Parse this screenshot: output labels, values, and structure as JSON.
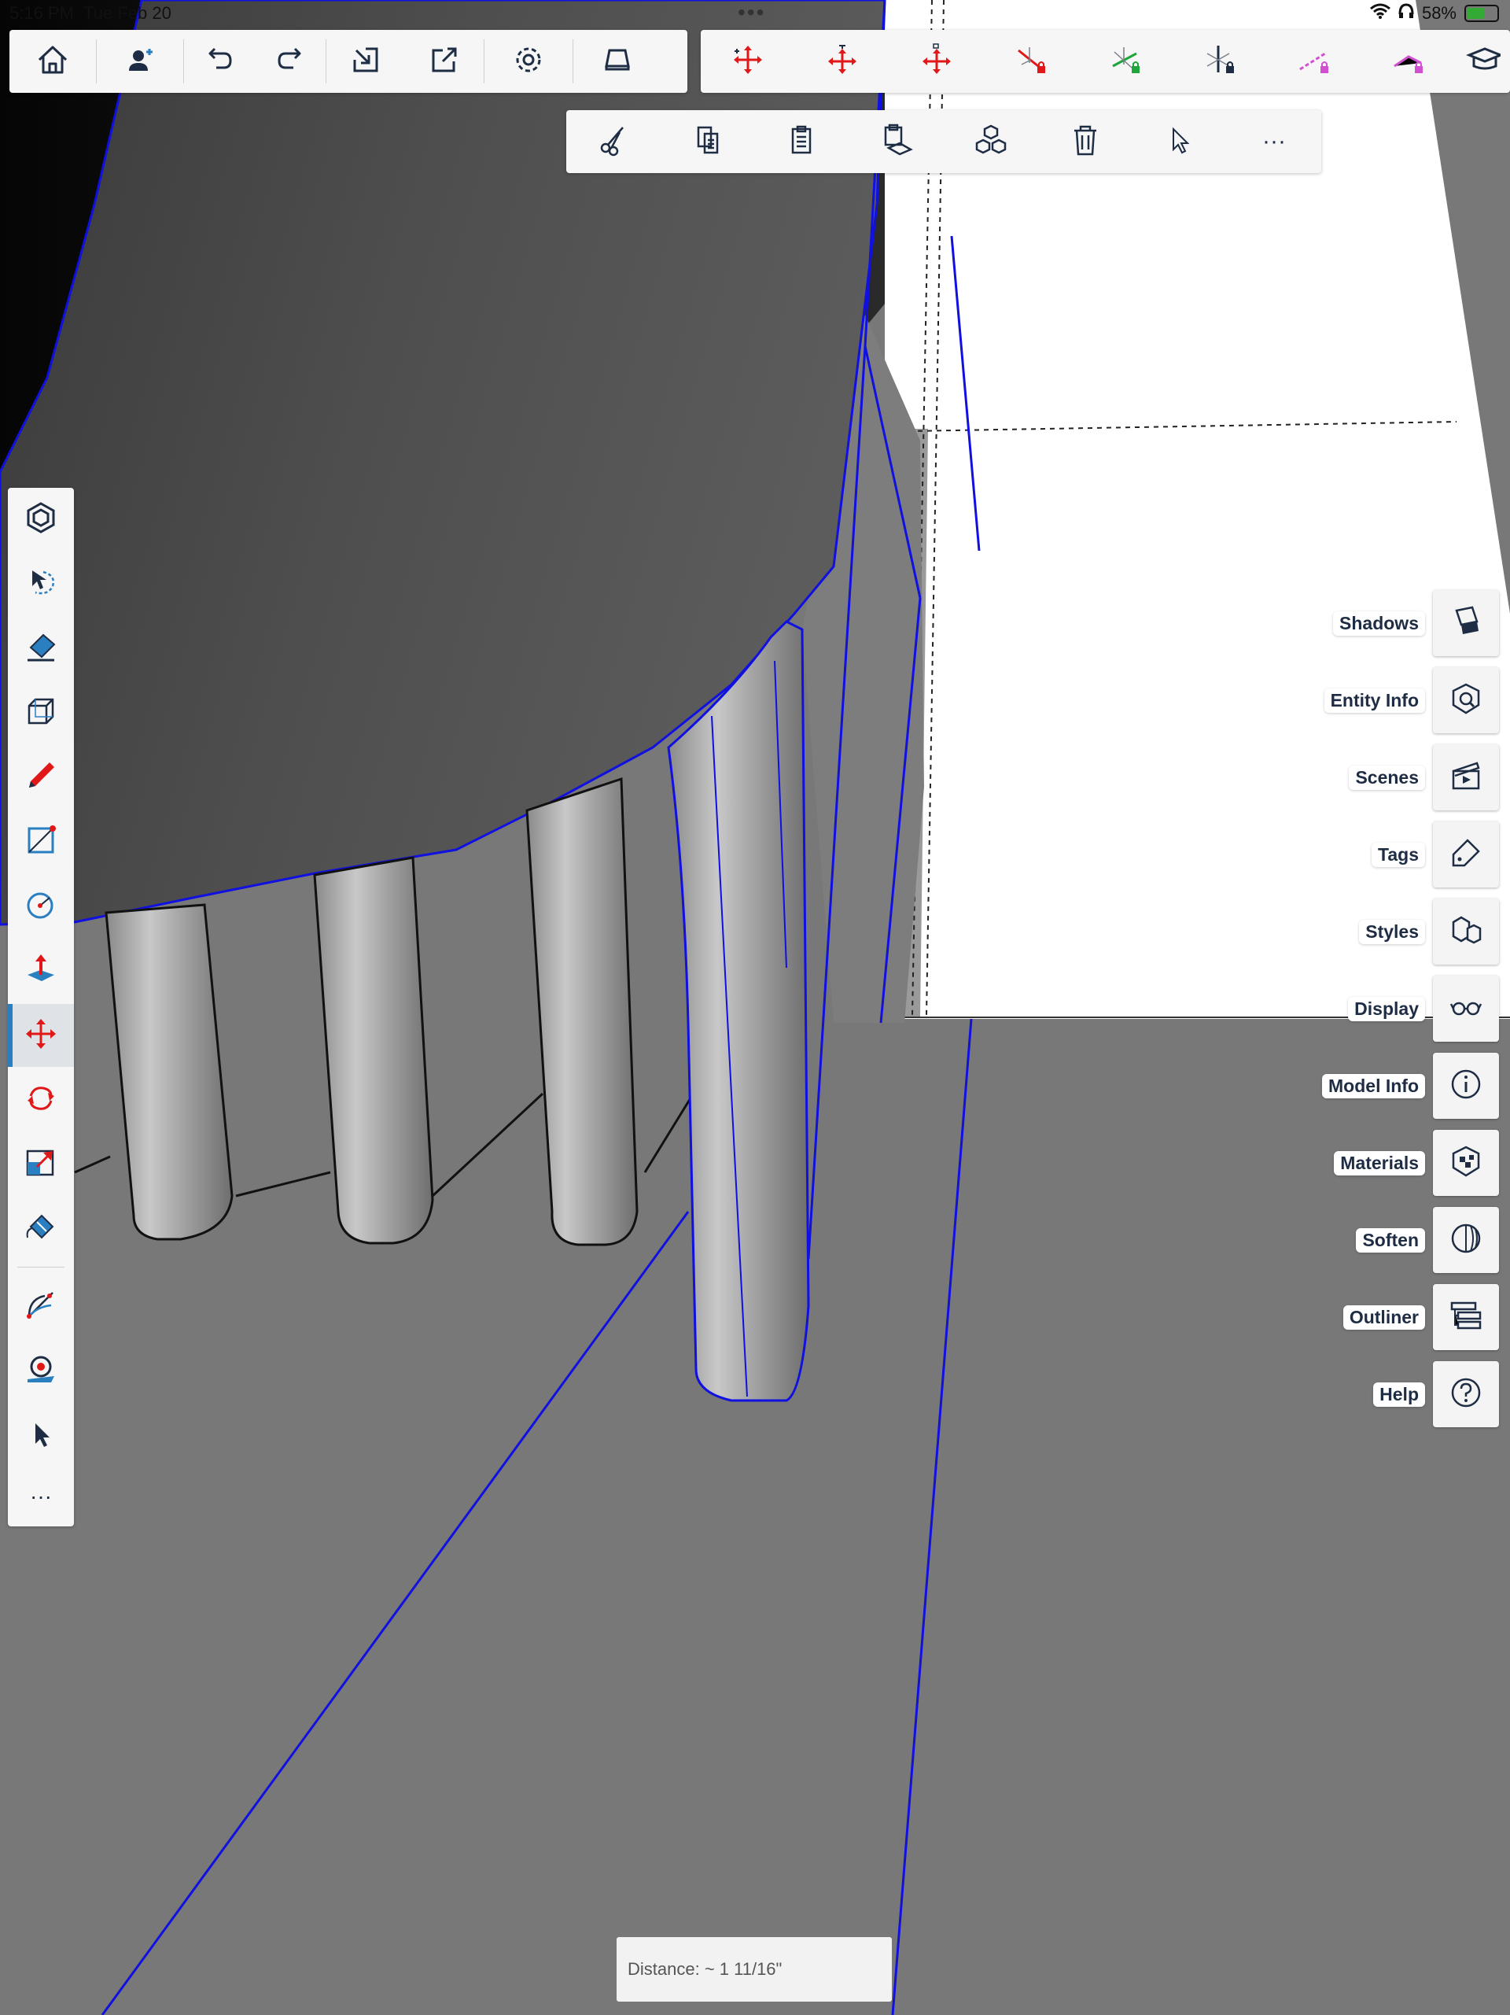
{
  "status_bar": {
    "time": "5:16 PM",
    "date": "Tue Feb 20",
    "dots": "•••",
    "battery": "58%"
  },
  "main_toolbar": [
    {
      "name": "home-button",
      "icon": "home-icon"
    },
    {
      "name": "add-user-button",
      "icon": "add-user-icon"
    },
    {
      "name": "undo-button",
      "icon": "undo-icon"
    },
    {
      "name": "redo-button",
      "icon": "redo-icon"
    },
    {
      "name": "import-button",
      "icon": "import-icon"
    },
    {
      "name": "export-button",
      "icon": "export-icon"
    },
    {
      "name": "settings-button",
      "icon": "gear-icon"
    },
    {
      "name": "view-button",
      "icon": "view-icon"
    }
  ],
  "inference_toolbar": [
    {
      "name": "move-inference-1",
      "icon": "move-arrows-icon"
    },
    {
      "name": "move-inference-2",
      "icon": "move-arrows-down-icon"
    },
    {
      "name": "move-inference-3",
      "icon": "move-arrows-up-icon"
    },
    {
      "name": "lock-red-axis",
      "icon": "red-axis-lock-icon"
    },
    {
      "name": "lock-green-axis",
      "icon": "green-axis-lock-icon"
    },
    {
      "name": "lock-blue-axis",
      "icon": "blue-axis-lock-icon"
    },
    {
      "name": "lock-magenta-1",
      "icon": "magenta-lock-icon"
    },
    {
      "name": "lock-magenta-2",
      "icon": "magenta-line-lock-icon"
    },
    {
      "name": "extra-tool",
      "icon": "cap-icon"
    }
  ],
  "edit_toolbar": [
    {
      "name": "cut-button",
      "icon": "scissors-icon"
    },
    {
      "name": "copy-button",
      "icon": "copy-icon"
    },
    {
      "name": "paste-button",
      "icon": "paste-icon"
    },
    {
      "name": "paste-in-place-button",
      "icon": "paste-in-place-icon"
    },
    {
      "name": "make-component-button",
      "icon": "components-icon"
    },
    {
      "name": "delete-button",
      "icon": "trash-icon"
    },
    {
      "name": "select-button",
      "icon": "cursor-icon"
    },
    {
      "name": "more-button",
      "icon": "more-icon",
      "label": "···"
    }
  ],
  "left_toolbar": [
    {
      "name": "3d-warehouse-tool",
      "icon": "warehouse-icon"
    },
    {
      "name": "lasso-select-tool",
      "icon": "lasso-icon"
    },
    {
      "name": "eraser-tool",
      "icon": "eraser-icon"
    },
    {
      "name": "box-tool",
      "icon": "box-icon"
    },
    {
      "name": "pencil-tool",
      "icon": "pencil-icon"
    },
    {
      "name": "rectangle-tool",
      "icon": "rectangle-icon"
    },
    {
      "name": "circle-tool",
      "icon": "circle-icon"
    },
    {
      "name": "push-pull-tool",
      "icon": "push-pull-icon"
    },
    {
      "name": "move-tool",
      "icon": "move-icon",
      "active": true
    },
    {
      "name": "rotate-tool",
      "icon": "rotate-icon"
    },
    {
      "name": "scale-tool",
      "icon": "scale-icon"
    },
    {
      "name": "paint-tool",
      "icon": "paint-bucket-icon"
    },
    {
      "name": "protractor-tool",
      "icon": "protractor-icon"
    },
    {
      "name": "tape-measure-tool",
      "icon": "tape-measure-icon"
    },
    {
      "name": "select-tool",
      "icon": "cursor-icon"
    },
    {
      "name": "more-tools",
      "icon": "more-icon",
      "label": "···"
    }
  ],
  "right_panel": [
    {
      "label": "Shadows",
      "icon": "shadows-icon"
    },
    {
      "label": "Entity Info",
      "icon": "entity-info-icon"
    },
    {
      "label": "Scenes",
      "icon": "scenes-icon"
    },
    {
      "label": "Tags",
      "icon": "tag-icon"
    },
    {
      "label": "Styles",
      "icon": "styles-icon"
    },
    {
      "label": "Display",
      "icon": "glasses-icon"
    },
    {
      "label": "Model Info",
      "icon": "info-icon"
    },
    {
      "label": "Materials",
      "icon": "materials-icon"
    },
    {
      "label": "Soften",
      "icon": "soften-icon"
    },
    {
      "label": "Outliner",
      "icon": "outliner-icon"
    },
    {
      "label": "Help",
      "icon": "help-icon"
    }
  ],
  "measurement": {
    "label": "Distance: ~ 1 11/16\""
  },
  "colors": {
    "selection": "#1010e0",
    "floor": "#787878",
    "toolbar_bg": "#f6f6f7",
    "accent": "#2a7fc0",
    "icon_dark": "#1e2d44",
    "red": "#e01818"
  }
}
